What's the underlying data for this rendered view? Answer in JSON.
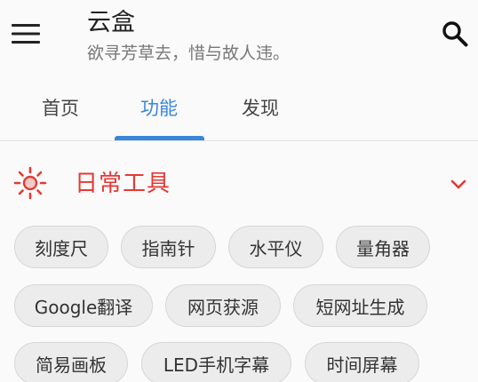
{
  "header": {
    "title": "云盒",
    "subtitle": "欲寻芳草去，惜与故人违。"
  },
  "tabs": [
    {
      "label": "首页",
      "active": false
    },
    {
      "label": "功能",
      "active": true
    },
    {
      "label": "发现",
      "active": false
    }
  ],
  "section": {
    "title": "日常工具",
    "icon": "sun-icon",
    "expanded": true
  },
  "tools": [
    {
      "label": "刻度尺"
    },
    {
      "label": "指南针"
    },
    {
      "label": "水平仪"
    },
    {
      "label": "量角器"
    },
    {
      "label": "Google翻译"
    },
    {
      "label": "网页获源"
    },
    {
      "label": "短网址生成"
    },
    {
      "label": "简易画板"
    },
    {
      "label": "LED手机字幕"
    },
    {
      "label": "时间屏幕"
    }
  ],
  "colors": {
    "accent": "#3a86d9",
    "section_title": "#e53935",
    "chip_bg": "#ececec"
  }
}
